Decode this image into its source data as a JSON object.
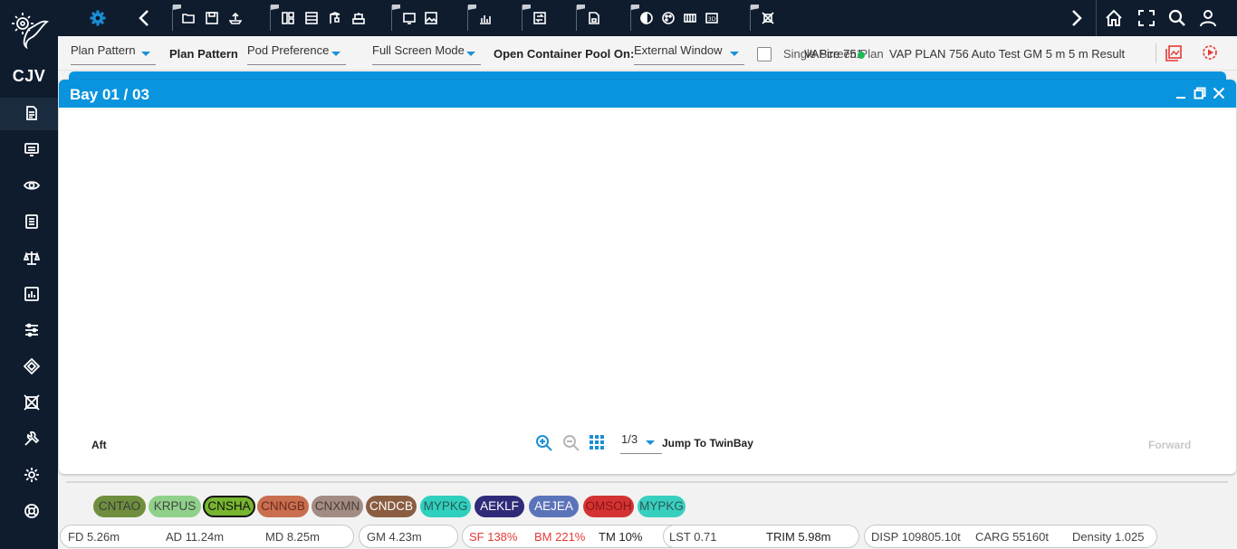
{
  "app_code": "CJV",
  "left_rail": {
    "items": [
      {
        "icon": "document-icon"
      },
      {
        "icon": "monitor-icon"
      },
      {
        "icon": "eye-icon"
      },
      {
        "icon": "checklist-icon"
      },
      {
        "icon": "scale-icon"
      },
      {
        "icon": "bar-chart-icon"
      },
      {
        "icon": "sliders-icon"
      },
      {
        "icon": "diamond-icon"
      },
      {
        "icon": "crossed-box-icon"
      },
      {
        "icon": "tools-icon"
      },
      {
        "icon": "gear-icon"
      },
      {
        "icon": "lifebuoy-icon"
      }
    ]
  },
  "toolbar2": {
    "plan_pattern_dd": "Plan Pattern",
    "plan_pattern_label": "Plan Pattern",
    "pod_preference_dd": "Pod Preference",
    "full_screen_dd": "Full Screen Mode",
    "open_pool_label": "Open Container Pool On:",
    "open_pool_value": "External Window",
    "single_pane_label": "Single Screen Plan",
    "vessel_code": "VAPire 751",
    "vessel_name": "VAP PLAN 756 Auto Test GM 5 m 5 m Result"
  },
  "panel": {
    "title": "Bay 01 / 03",
    "aft_label": "Aft",
    "forward_label": "Forward",
    "page": "1/3",
    "jump_label": "Jump To TwinBay"
  },
  "ports": [
    {
      "code": "CNTAO",
      "bg": "#6f8f3e",
      "fg": "#3b3b3b"
    },
    {
      "code": "KRPUS",
      "bg": "#8fd18a",
      "fg": "#444444"
    },
    {
      "code": "CNSHA",
      "bg": "#77b52f",
      "fg": "#111111"
    },
    {
      "code": "CNNGB",
      "bg": "#c96e4f",
      "fg": "#6a2b1d"
    },
    {
      "code": "CNXMN",
      "bg": "#a28c83",
      "fg": "#4e3c35"
    },
    {
      "code": "CNDCB",
      "bg": "#8a5d42",
      "fg": "#ffffff"
    },
    {
      "code": "MYPKG",
      "bg": "#2fd0be",
      "fg": "#2b5a55"
    },
    {
      "code": "AEKLF",
      "bg": "#2f2b78",
      "fg": "#ffffff"
    },
    {
      "code": "AEJEA",
      "bg": "#5b73b9",
      "fg": "#ffffff"
    },
    {
      "code": "OMSOH",
      "bg": "#d33333",
      "fg": "#8a1515"
    },
    {
      "code": "MYPKG",
      "bg": "#39cfbf",
      "fg": "#2b5a55"
    }
  ],
  "stats": {
    "fd": "FD 5.26m",
    "ad": "AD 11.24m",
    "md": "MD 8.25m",
    "gm": "GM 4.23m",
    "sf": "SF 138%",
    "bm": "BM 221%",
    "tm": "TM 10%",
    "lst": "LST 0.71",
    "trim": "TRIM 5.98m",
    "disp": "DISP 109805.10t",
    "carg": "CARG 55160t",
    "density": "Density 1.025"
  },
  "colors": {
    "rail_bg": "#0e1c2e",
    "accent": "#0a94de",
    "alert": "#e53935"
  }
}
